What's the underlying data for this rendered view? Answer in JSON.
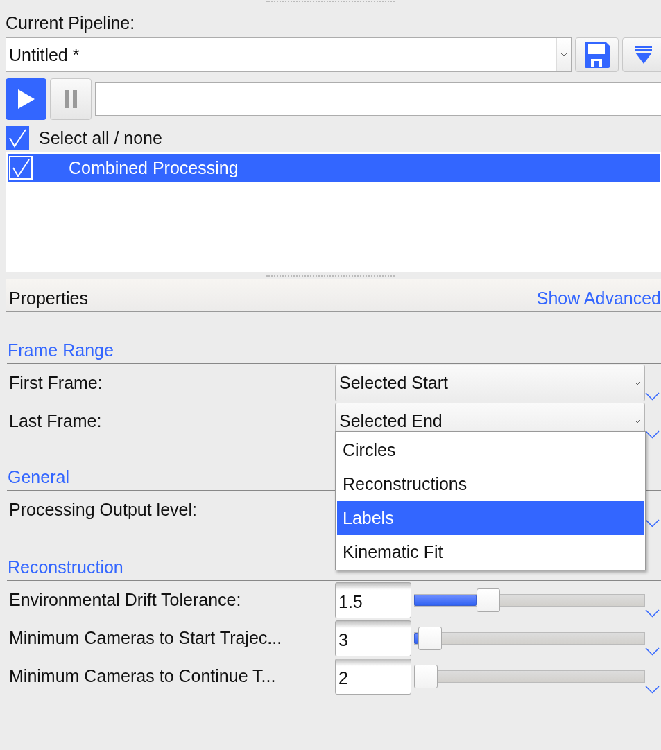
{
  "pipeline": {
    "label": "Current Pipeline:",
    "value": "Untitled *"
  },
  "select_all": {
    "label": "Select all / none",
    "checked": true
  },
  "pipeline_steps": [
    {
      "label": "Combined Processing",
      "checked": true,
      "selected": true
    }
  ],
  "properties": {
    "title": "Properties",
    "link": "Show Advanced"
  },
  "sections": [
    {
      "title": "Frame Range",
      "rows": [
        {
          "kind": "combo",
          "label": "First Frame:",
          "value": "Selected Start"
        },
        {
          "kind": "combo",
          "label": "Last Frame:",
          "value": "Selected End",
          "open": true
        }
      ]
    },
    {
      "title": "General",
      "rows": [
        {
          "kind": "covered",
          "label": "Processing Output level:"
        }
      ]
    },
    {
      "title": "Reconstruction",
      "rows": [
        {
          "kind": "slider",
          "label": "Environmental Drift Tolerance:",
          "value": "1.5",
          "level": 0.3
        },
        {
          "kind": "slider",
          "label": "Minimum Cameras to Start Trajec...",
          "value": "3",
          "level": 0.02
        },
        {
          "kind": "slider",
          "label": "Minimum Cameras to Continue T...",
          "value": "2",
          "level": 0
        }
      ]
    }
  ],
  "dropdown_menu": {
    "items": [
      {
        "label": "Circles",
        "selected": false
      },
      {
        "label": "Reconstructions",
        "selected": false
      },
      {
        "label": "Labels",
        "selected": true
      },
      {
        "label": "Kinematic Fit",
        "selected": false
      }
    ]
  }
}
